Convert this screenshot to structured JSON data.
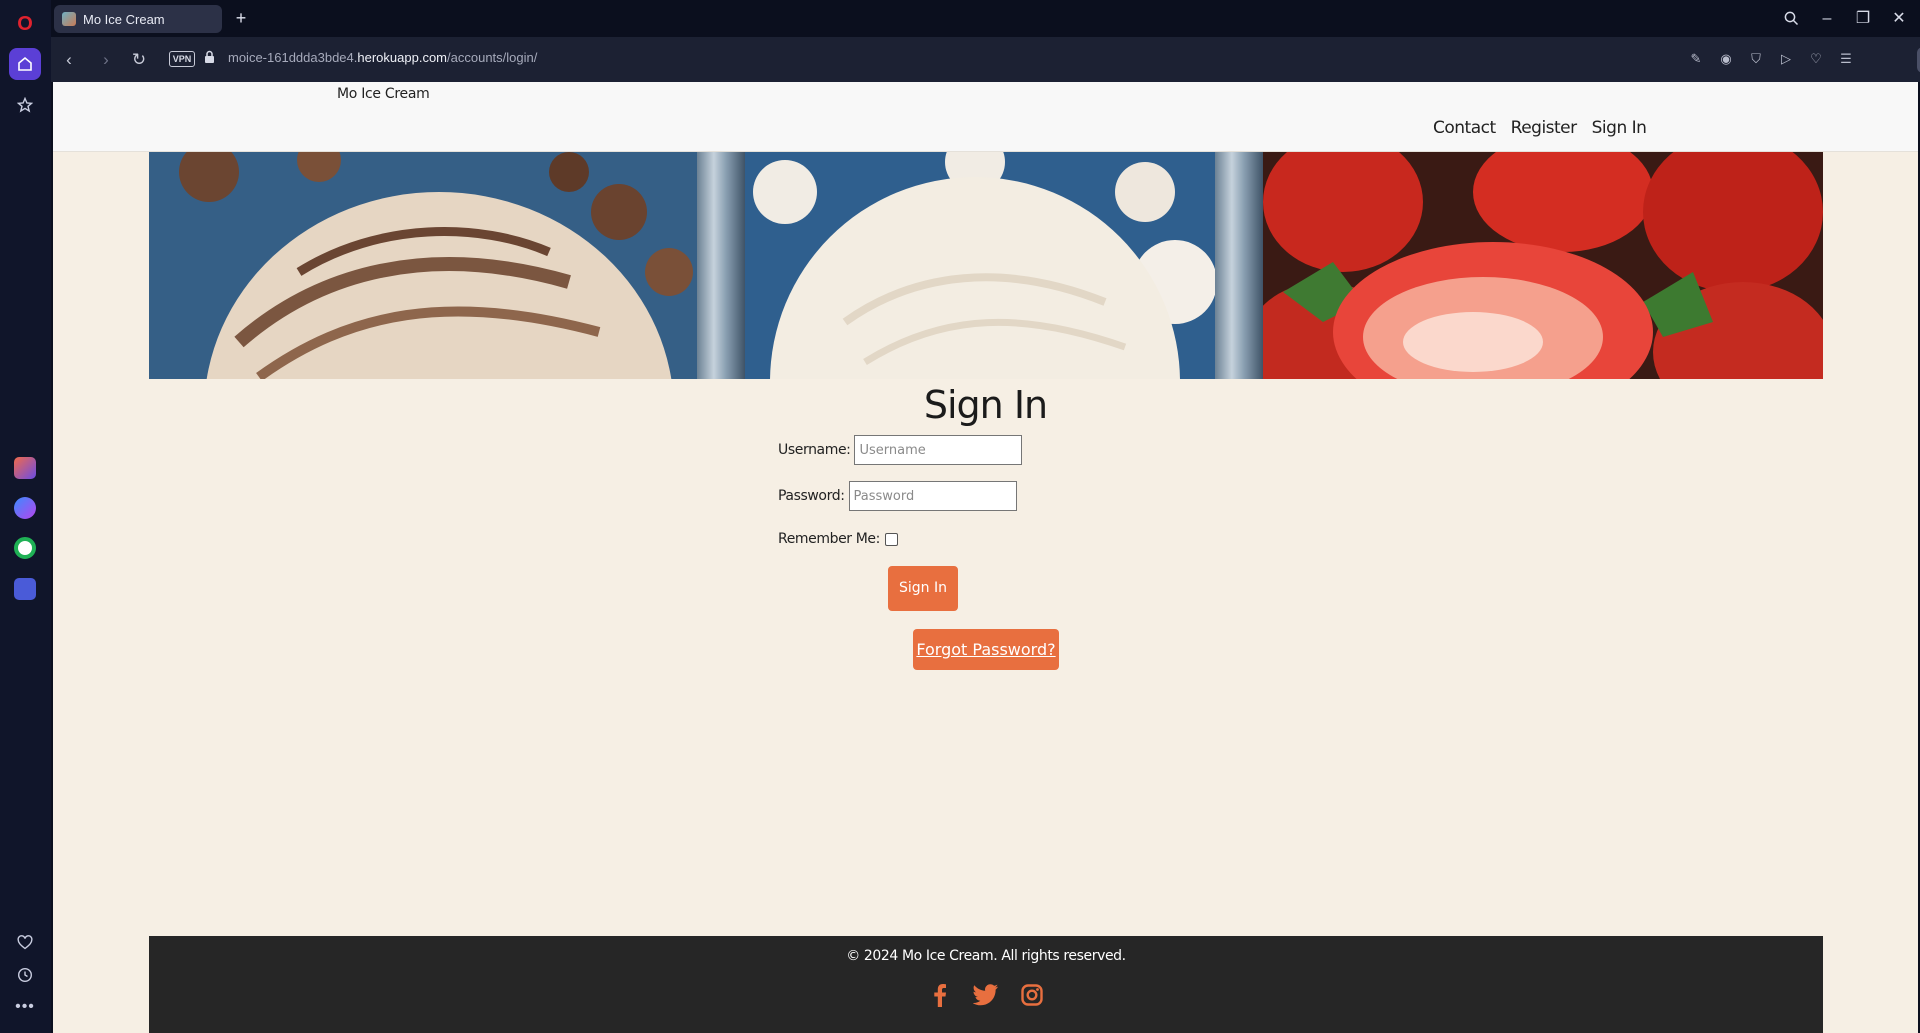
{
  "browser": {
    "tab_title": "Mo Ice Cream",
    "new_tab": "+",
    "vpn_label": "VPN",
    "url_prefix": "moice-161ddda3bde4.",
    "url_host": "herokuapp.com",
    "url_path": "/accounts/login/"
  },
  "site": {
    "brand": "Mo Ice Cream",
    "nav": [
      "Contact",
      "Register",
      "Sign In"
    ]
  },
  "signin": {
    "title": "Sign In",
    "username_label": "Username:",
    "username_placeholder": "Username",
    "password_label": "Password:",
    "password_placeholder": "Password",
    "remember_label": "Remember Me:",
    "remember_checked": false,
    "submit_label": "Sign In",
    "forgot_label": "Forgot Password?"
  },
  "footer": {
    "copyright": "© 2024 Mo Ice Cream. All rights reserved.",
    "socials": [
      "facebook-icon",
      "twitter-icon",
      "instagram-icon"
    ]
  },
  "colors": {
    "accent": "#e86f3f",
    "page_bg": "#f6efe4",
    "footer_bg": "#262626"
  }
}
